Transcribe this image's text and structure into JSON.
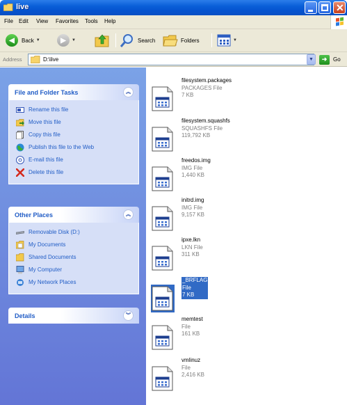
{
  "window": {
    "title": "live"
  },
  "menu": {
    "items": [
      "File",
      "Edit",
      "View",
      "Favorites",
      "Tools",
      "Help"
    ]
  },
  "toolbar": {
    "back_label": "Back",
    "search_label": "Search",
    "folders_label": "Folders"
  },
  "address": {
    "label": "Address",
    "value": "D:\\live",
    "go_label": "Go"
  },
  "tasks_panel": {
    "title": "File and Folder Tasks",
    "items": [
      {
        "label": "Rename this file",
        "icon": "rename-icon"
      },
      {
        "label": "Move this file",
        "icon": "move-icon"
      },
      {
        "label": "Copy this file",
        "icon": "copy-icon"
      },
      {
        "label": "Publish this file to the Web",
        "icon": "publish-web-icon"
      },
      {
        "label": "E-mail this file",
        "icon": "email-icon"
      },
      {
        "label": "Delete this file",
        "icon": "delete-icon"
      }
    ]
  },
  "places_panel": {
    "title": "Other Places",
    "items": [
      {
        "label": "Removable Disk (D:)",
        "icon": "removable-disk-icon"
      },
      {
        "label": "My Documents",
        "icon": "my-documents-icon"
      },
      {
        "label": "Shared Documents",
        "icon": "shared-documents-icon"
      },
      {
        "label": "My Computer",
        "icon": "my-computer-icon"
      },
      {
        "label": "My Network Places",
        "icon": "network-places-icon"
      }
    ]
  },
  "details_panel": {
    "title": "Details"
  },
  "files": [
    {
      "name": "filesystem.packages",
      "type": "PACKAGES File",
      "size": "7 KB",
      "selected": false
    },
    {
      "name": "filesystem.squashfs",
      "type": "SQUASHFS File",
      "size": "119,792 KB",
      "selected": false
    },
    {
      "name": "freedos.img",
      "type": "IMG File",
      "size": "1,440 KB",
      "selected": false
    },
    {
      "name": "initrd.img",
      "type": "IMG File",
      "size": "9,157 KB",
      "selected": false
    },
    {
      "name": "ipxe.lkn",
      "type": "LKN File",
      "size": "311 KB",
      "selected": false
    },
    {
      "name": "_BRFLAG",
      "type": "File",
      "size": "7 KB",
      "selected": true
    },
    {
      "name": "memtest",
      "type": "File",
      "size": "161 KB",
      "selected": false
    },
    {
      "name": "vmlinuz",
      "type": "File",
      "size": "2,416 KB",
      "selected": false
    }
  ],
  "colors": {
    "titlebar": "#0a5fd8",
    "taskpane": "#6f8fe0",
    "link": "#215dc6",
    "selection": "#316ac5"
  }
}
